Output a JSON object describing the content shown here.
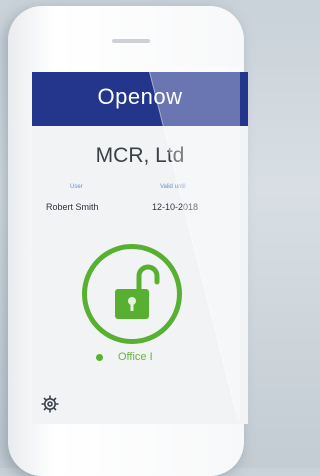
{
  "app": {
    "name": "Openow",
    "header_color": "#24358c"
  },
  "account": {
    "company": "MCR, Ltd"
  },
  "details": {
    "user_label": "User",
    "user_value": "Robert Smith",
    "date_label": "Valid until",
    "date_value": "12-10-2018"
  },
  "lock": {
    "state": "unlocked",
    "icon": "padlock-open-icon",
    "accent_color": "#58b030",
    "door_name": "Office I"
  },
  "footer": {
    "settings_icon": "gear-icon"
  }
}
